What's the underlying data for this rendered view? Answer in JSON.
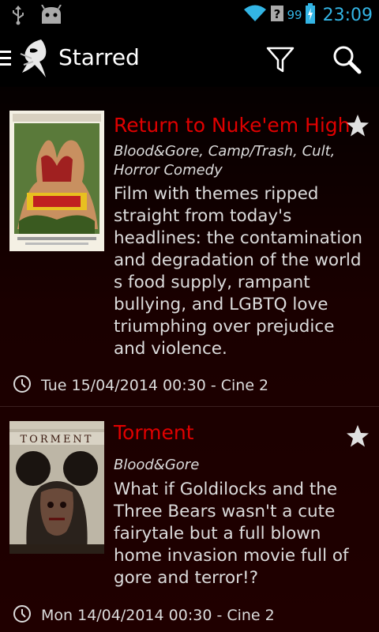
{
  "statusbar": {
    "battery_pct": "99",
    "time": "23:09",
    "icons": [
      "usb-icon",
      "android-debug-icon",
      "wifi-icon",
      "no-signal-icon",
      "battery-charging-icon"
    ]
  },
  "actionbar": {
    "title": "Starred",
    "icons": [
      "menu-icon",
      "app-logo-icon",
      "filter-icon",
      "search-icon"
    ]
  },
  "films": [
    {
      "title": "Return to Nuke'em High",
      "genres": "Blood&Gore, Camp/Trash, Cult, Horror Comedy",
      "description": "Film with themes ripped straight from today's headlines: the contamination and degradation of the world s food supply, rampant bullying, and LGBTQ love triumphing over prejudice and violence.",
      "when": "Tue 15/04/2014 00:30 - Cine 2",
      "starred": true
    },
    {
      "title": "Torment",
      "genres": "Blood&Gore",
      "description": "What if Goldilocks and the Three Bears wasn't a cute fairytale but a full blown home invasion movie full of gore and terror!?",
      "when": "Mon 14/04/2014 00:30 - Cine 2",
      "starred": true
    }
  ],
  "colors": {
    "accent": "#33b5e5",
    "title_red": "#e00000",
    "text": "#dcdcdc"
  }
}
